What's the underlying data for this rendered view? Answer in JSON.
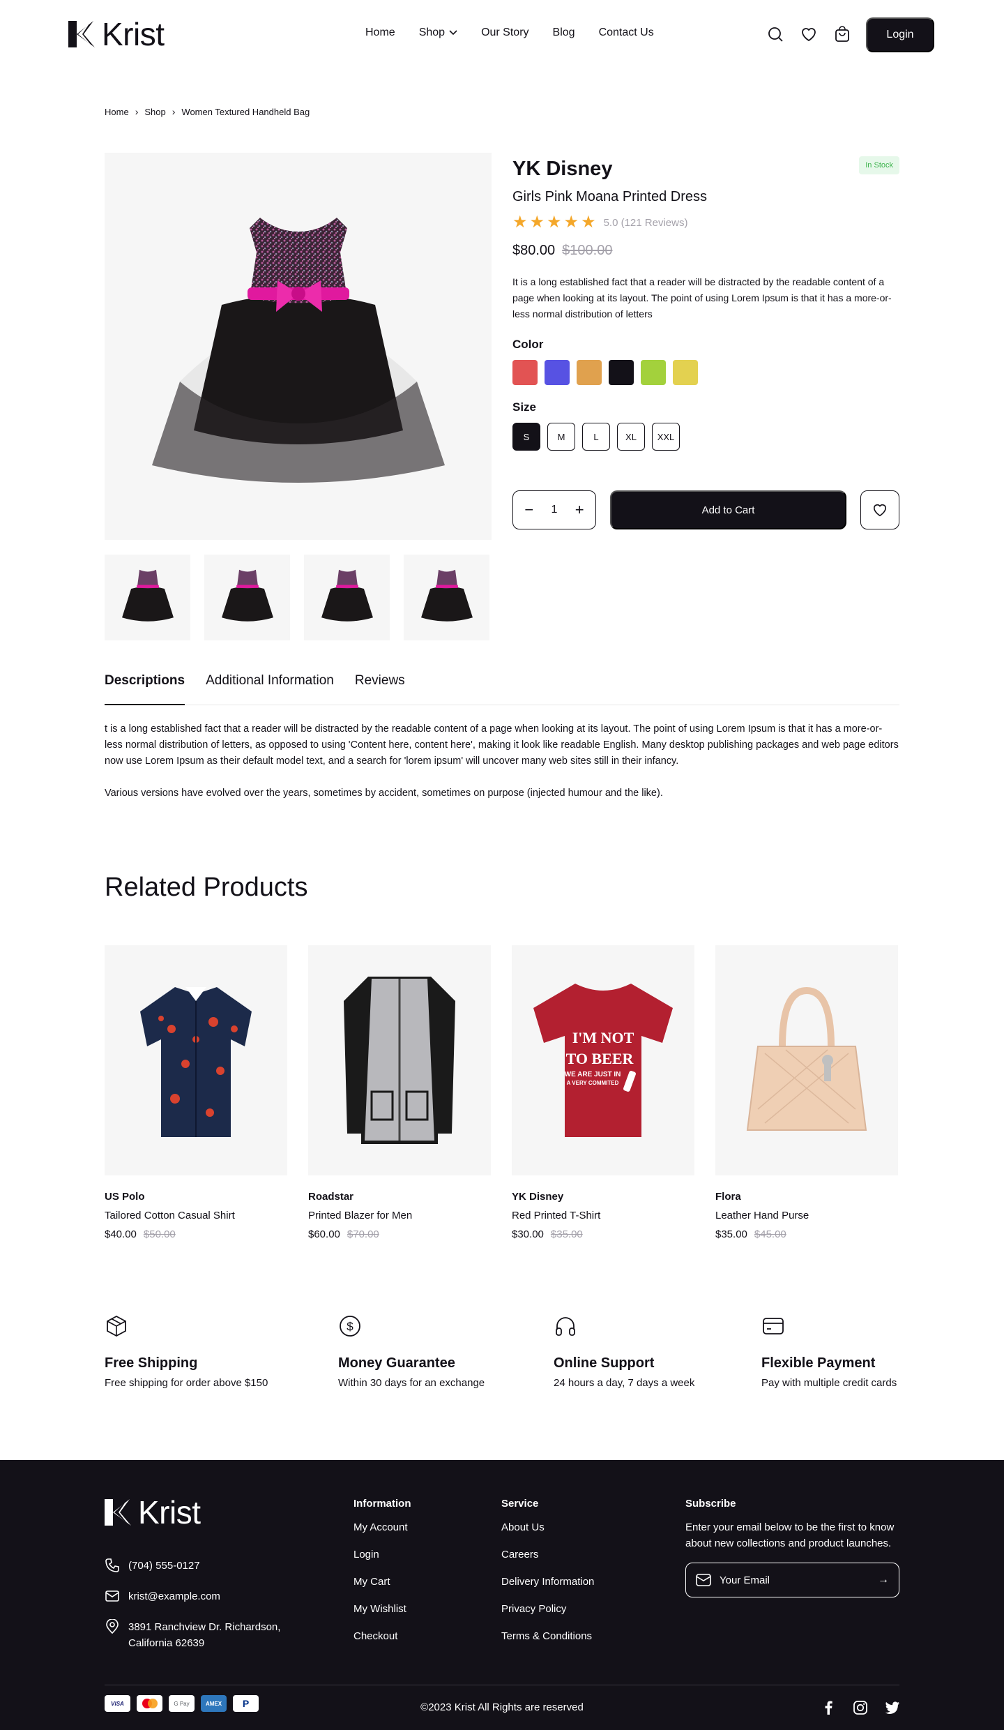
{
  "header": {
    "logo_text": "Krist",
    "nav": [
      {
        "label": "Home"
      },
      {
        "label": "Shop"
      },
      {
        "label": "Our Story"
      },
      {
        "label": "Blog"
      },
      {
        "label": "Contact Us"
      }
    ],
    "login_label": "Login"
  },
  "breadcrumb": [
    "Home",
    "Shop",
    "Women Textured Handheld Bag"
  ],
  "product": {
    "brand": "YK Disney",
    "stock": "In Stock",
    "name": "Girls Pink Moana Printed Dress",
    "rating_text": "5.0 (121 Reviews)",
    "rating": 5,
    "price": "$80.00",
    "old_price": "$100.00",
    "description": "It is a long established fact that a reader will be distracted by the readable content of a page when looking at its layout. The point of using Lorem Ipsum is that it has a more-or-less normal distribution of letters",
    "color_label": "Color",
    "colors": [
      "#e25353",
      "#5752e3",
      "#e0a14e",
      "#131118",
      "#a3d13c",
      "#e3d150"
    ],
    "size_label": "Size",
    "sizes": [
      "S",
      "M",
      "L",
      "XL",
      "XXL"
    ],
    "selected_size": "S",
    "quantity": "1",
    "add_to_cart": "Add to Cart"
  },
  "tabs": [
    "Descriptions",
    "Additional Information",
    "Reviews"
  ],
  "tab_content": {
    "p1": "t is a long established fact that a reader will be distracted by the readable content of a page when looking at its layout. The point of using Lorem Ipsum is that it has a more-or-less normal distribution of letters, as opposed to using 'Content here, content here', making it look like readable English. Many desktop publishing packages and web page editors now use Lorem Ipsum as their default model text, and a search for 'lorem ipsum' will uncover many web sites still in their infancy.",
    "p2": "Various versions have evolved over the years, sometimes by accident, sometimes on purpose (injected humour and the like)."
  },
  "related": {
    "title": "Related Products",
    "items": [
      {
        "brand": "US Polo",
        "name": "Tailored Cotton Casual Shirt",
        "price": "$40.00",
        "old_price": "$50.00"
      },
      {
        "brand": "Roadstar",
        "name": "Printed Blazer for Men",
        "price": "$60.00",
        "old_price": "$70.00"
      },
      {
        "brand": "YK Disney",
        "name": "Red Printed T-Shirt",
        "price": "$30.00",
        "old_price": "$35.00",
        "tshirt_lines": [
          "I'M NOT",
          "TO BEER",
          "WE ARE JUST IN",
          "A VERY COMMITED"
        ]
      },
      {
        "brand": "Flora",
        "name": "Leather Hand Purse",
        "price": "$35.00",
        "old_price": "$45.00"
      }
    ]
  },
  "features": [
    {
      "icon": "box-icon",
      "title": "Free Shipping",
      "text": "Free shipping for order above $150"
    },
    {
      "icon": "dollar-icon",
      "title": "Money Guarantee",
      "text": "Within 30 days for an exchange"
    },
    {
      "icon": "headphones-icon",
      "title": "Online Support",
      "text": "24 hours a day, 7 days a week"
    },
    {
      "icon": "credit-card-icon",
      "title": "Flexible Payment",
      "text": "Pay with multiple credit cards"
    }
  ],
  "footer": {
    "logo_text": "Krist",
    "phone": "(704) 555-0127",
    "email": "krist@example.com",
    "address_line1": "3891 Ranchview Dr. Richardson,",
    "address_line2": "California 62639",
    "information": {
      "title": "Information",
      "links": [
        "My Account",
        "Login",
        "My Cart",
        "My Wishlist",
        "Checkout"
      ]
    },
    "service": {
      "title": "Service",
      "links": [
        "About Us",
        "Careers",
        "Delivery Information",
        "Privacy Policy",
        "Terms & Conditions"
      ]
    },
    "subscribe": {
      "title": "Subscribe",
      "text": "Enter your email below to be the first to know about new collections and product launches.",
      "placeholder": "Your Email"
    },
    "payments": [
      "VISA",
      "MC",
      "G Pay",
      "AMEX",
      "PayPal"
    ],
    "copyright": "©2023 Krist All Rights are reserved"
  }
}
